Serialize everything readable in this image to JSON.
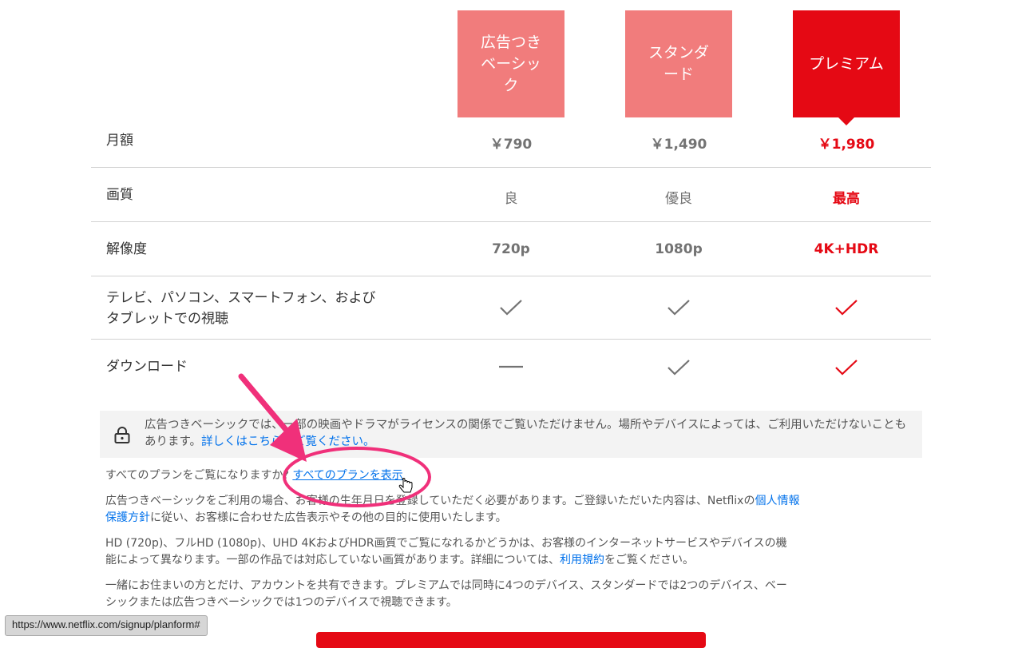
{
  "plans": [
    {
      "name": "広告つき\nベーシッ\nク"
    },
    {
      "name": "スタンダ\nード"
    },
    {
      "name": "プレミアム"
    }
  ],
  "rows": {
    "price": {
      "label": "月額",
      "values": [
        "￥790",
        "￥1,490",
        "￥1,980"
      ]
    },
    "quality": {
      "label": "画質",
      "values": [
        "良",
        "優良",
        "最高"
      ]
    },
    "resolution": {
      "label": "解像度",
      "values": [
        "720p",
        "1080p",
        "4K+HDR"
      ]
    },
    "devices": {
      "label": "テレビ、パソコン、スマートフォン、および\nタブレットでの視聴",
      "values": [
        "check",
        "check",
        "check"
      ]
    },
    "download": {
      "label": "ダウンロード",
      "values": [
        "dash",
        "check",
        "check"
      ]
    }
  },
  "notice": {
    "text": "広告つきベーシックでは、一部の映画やドラマがライセンスの関係でご覧いただけません。場所やデバイスによっては、ご利用いただけないこともあります。",
    "link": "詳しくはこちらをご覧ください。"
  },
  "all_plans": {
    "prompt": "すべてのプランをご覧になりますか?",
    "link": "すべてのプランを表示"
  },
  "para_ads": {
    "before": "広告つきベーシックをご利用の場合、お客様の生年月日を登録していただく必要があります。ご登録いただいた内容は、Netflixの",
    "link": "個人情報保護方針",
    "after": "に従い、お客様に合わせた広告表示やその他の目的に使用いたします。"
  },
  "para_hd": {
    "before": "HD (720p)、フルHD (1080p)、UHD 4KおよびHDR画質でご覧になれるかどうかは、お客様のインターネットサービスやデバイスの機能によって異なります。一部の作品では対応していない画質があります。詳細については、",
    "link": "利用規約",
    "after": "をご覧ください。"
  },
  "para_share": {
    "text": "一緒にお住まいの方とだけ、アカウントを共有できます。プレミアムでは同時に4つのデバイス、スタンダードでは2つのデバイス、ベーシックまたは広告つきベーシックでは1つのデバイスで視聴できます。"
  },
  "status_url": "https://www.netflix.com/signup/planform#",
  "colors": {
    "brand_red": "#e50914",
    "plan_unselected": "#f17c7c",
    "link_blue": "#0071eb",
    "annotation_pink": "#f0307a"
  },
  "icons": [
    "lock-icon",
    "check-icon",
    "dash-icon",
    "pointer-hand-icon",
    "annotation-arrow",
    "annotation-circle"
  ]
}
